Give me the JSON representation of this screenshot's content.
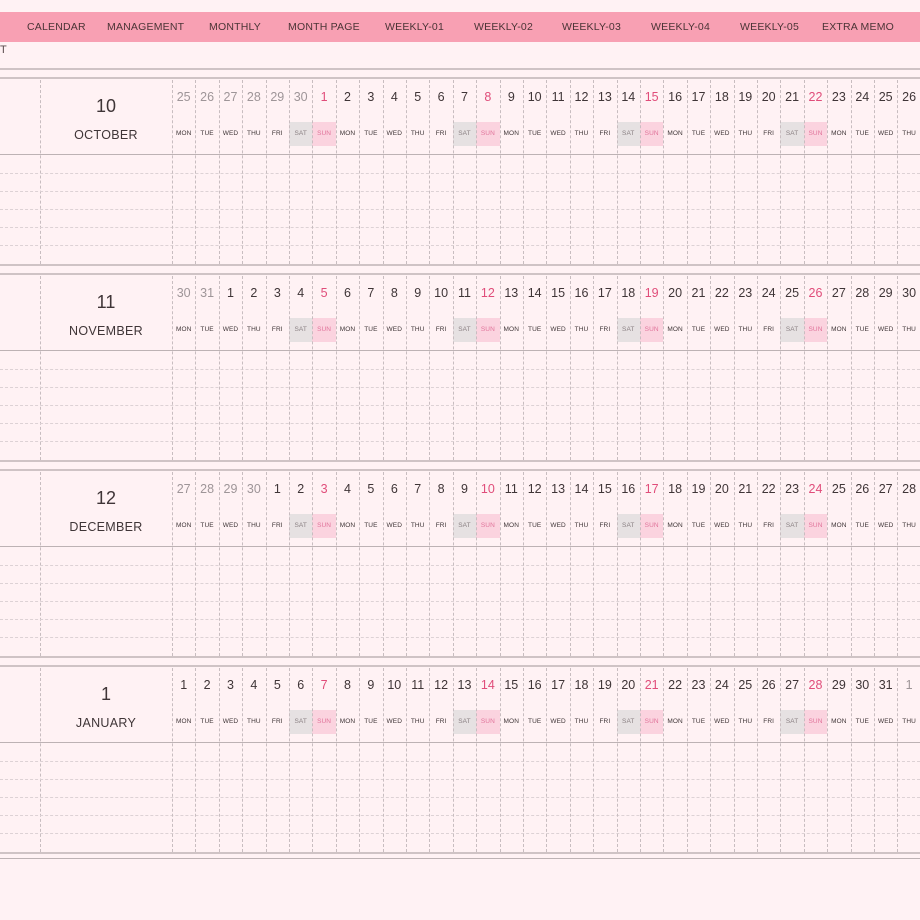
{
  "nav": {
    "tabs": [
      "CALENDAR",
      "MANAGEMENT",
      "MONTHLY",
      "MONTH PAGE",
      "WEEKLY-01",
      "WEEKLY-02",
      "WEEKLY-03",
      "WEEKLY-04",
      "WEEKLY-05",
      "EXTRA MEMO"
    ]
  },
  "subheader": {
    "text": "T"
  },
  "colors": {
    "nav_bg": "#f8a0b3",
    "page_bg": "#fff2f4",
    "sunday": "#e04d7a",
    "sunday_bg": "#fbd3df",
    "saturday_bg": "#e6e1e2"
  },
  "months": [
    {
      "number": "10",
      "name": "OCTOBER",
      "days": [
        {
          "d": "25",
          "wd": "MON",
          "muted": true
        },
        {
          "d": "26",
          "wd": "TUE",
          "muted": true
        },
        {
          "d": "27",
          "wd": "WED",
          "muted": true
        },
        {
          "d": "28",
          "wd": "THU",
          "muted": true
        },
        {
          "d": "29",
          "wd": "FRI",
          "muted": true
        },
        {
          "d": "30",
          "wd": "SAT",
          "muted": true
        },
        {
          "d": "1",
          "wd": "SUN"
        },
        {
          "d": "2",
          "wd": "MON"
        },
        {
          "d": "3",
          "wd": "TUE"
        },
        {
          "d": "4",
          "wd": "WED"
        },
        {
          "d": "5",
          "wd": "THU"
        },
        {
          "d": "6",
          "wd": "FRI"
        },
        {
          "d": "7",
          "wd": "SAT"
        },
        {
          "d": "8",
          "wd": "SUN"
        },
        {
          "d": "9",
          "wd": "MON"
        },
        {
          "d": "10",
          "wd": "TUE"
        },
        {
          "d": "11",
          "wd": "WED"
        },
        {
          "d": "12",
          "wd": "THU"
        },
        {
          "d": "13",
          "wd": "FRI"
        },
        {
          "d": "14",
          "wd": "SAT"
        },
        {
          "d": "15",
          "wd": "SUN"
        },
        {
          "d": "16",
          "wd": "MON"
        },
        {
          "d": "17",
          "wd": "TUE"
        },
        {
          "d": "18",
          "wd": "WED"
        },
        {
          "d": "19",
          "wd": "THU"
        },
        {
          "d": "20",
          "wd": "FRI"
        },
        {
          "d": "21",
          "wd": "SAT"
        },
        {
          "d": "22",
          "wd": "SUN"
        },
        {
          "d": "23",
          "wd": "MON"
        },
        {
          "d": "24",
          "wd": "TUE"
        },
        {
          "d": "25",
          "wd": "WED"
        },
        {
          "d": "26",
          "wd": "THU"
        }
      ]
    },
    {
      "number": "11",
      "name": "NOVEMBER",
      "days": [
        {
          "d": "30",
          "wd": "MON",
          "muted": true
        },
        {
          "d": "31",
          "wd": "TUE",
          "muted": true
        },
        {
          "d": "1",
          "wd": "WED"
        },
        {
          "d": "2",
          "wd": "THU"
        },
        {
          "d": "3",
          "wd": "FRI"
        },
        {
          "d": "4",
          "wd": "SAT"
        },
        {
          "d": "5",
          "wd": "SUN"
        },
        {
          "d": "6",
          "wd": "MON"
        },
        {
          "d": "7",
          "wd": "TUE"
        },
        {
          "d": "8",
          "wd": "WED"
        },
        {
          "d": "9",
          "wd": "THU"
        },
        {
          "d": "10",
          "wd": "FRI"
        },
        {
          "d": "11",
          "wd": "SAT"
        },
        {
          "d": "12",
          "wd": "SUN"
        },
        {
          "d": "13",
          "wd": "MON"
        },
        {
          "d": "14",
          "wd": "TUE"
        },
        {
          "d": "15",
          "wd": "WED"
        },
        {
          "d": "16",
          "wd": "THU"
        },
        {
          "d": "17",
          "wd": "FRI"
        },
        {
          "d": "18",
          "wd": "SAT"
        },
        {
          "d": "19",
          "wd": "SUN"
        },
        {
          "d": "20",
          "wd": "MON"
        },
        {
          "d": "21",
          "wd": "TUE"
        },
        {
          "d": "22",
          "wd": "WED"
        },
        {
          "d": "23",
          "wd": "THU"
        },
        {
          "d": "24",
          "wd": "FRI"
        },
        {
          "d": "25",
          "wd": "SAT"
        },
        {
          "d": "26",
          "wd": "SUN"
        },
        {
          "d": "27",
          "wd": "MON"
        },
        {
          "d": "28",
          "wd": "TUE"
        },
        {
          "d": "29",
          "wd": "WED"
        },
        {
          "d": "30",
          "wd": "THU"
        }
      ]
    },
    {
      "number": "12",
      "name": "DECEMBER",
      "days": [
        {
          "d": "27",
          "wd": "MON",
          "muted": true
        },
        {
          "d": "28",
          "wd": "TUE",
          "muted": true
        },
        {
          "d": "29",
          "wd": "WED",
          "muted": true
        },
        {
          "d": "30",
          "wd": "THU",
          "muted": true
        },
        {
          "d": "1",
          "wd": "FRI"
        },
        {
          "d": "2",
          "wd": "SAT"
        },
        {
          "d": "3",
          "wd": "SUN"
        },
        {
          "d": "4",
          "wd": "MON"
        },
        {
          "d": "5",
          "wd": "TUE"
        },
        {
          "d": "6",
          "wd": "WED"
        },
        {
          "d": "7",
          "wd": "THU"
        },
        {
          "d": "8",
          "wd": "FRI"
        },
        {
          "d": "9",
          "wd": "SAT"
        },
        {
          "d": "10",
          "wd": "SUN"
        },
        {
          "d": "11",
          "wd": "MON"
        },
        {
          "d": "12",
          "wd": "TUE"
        },
        {
          "d": "13",
          "wd": "WED"
        },
        {
          "d": "14",
          "wd": "THU"
        },
        {
          "d": "15",
          "wd": "FRI"
        },
        {
          "d": "16",
          "wd": "SAT"
        },
        {
          "d": "17",
          "wd": "SUN"
        },
        {
          "d": "18",
          "wd": "MON"
        },
        {
          "d": "19",
          "wd": "TUE"
        },
        {
          "d": "20",
          "wd": "WED"
        },
        {
          "d": "21",
          "wd": "THU"
        },
        {
          "d": "22",
          "wd": "FRI"
        },
        {
          "d": "23",
          "wd": "SAT"
        },
        {
          "d": "24",
          "wd": "SUN"
        },
        {
          "d": "25",
          "wd": "MON"
        },
        {
          "d": "26",
          "wd": "TUE"
        },
        {
          "d": "27",
          "wd": "WED"
        },
        {
          "d": "28",
          "wd": "THU"
        }
      ]
    },
    {
      "number": "1",
      "name": "JANUARY",
      "days": [
        {
          "d": "1",
          "wd": "MON"
        },
        {
          "d": "2",
          "wd": "TUE"
        },
        {
          "d": "3",
          "wd": "WED"
        },
        {
          "d": "4",
          "wd": "THU"
        },
        {
          "d": "5",
          "wd": "FRI"
        },
        {
          "d": "6",
          "wd": "SAT"
        },
        {
          "d": "7",
          "wd": "SUN"
        },
        {
          "d": "8",
          "wd": "MON"
        },
        {
          "d": "9",
          "wd": "TUE"
        },
        {
          "d": "10",
          "wd": "WED"
        },
        {
          "d": "11",
          "wd": "THU"
        },
        {
          "d": "12",
          "wd": "FRI"
        },
        {
          "d": "13",
          "wd": "SAT"
        },
        {
          "d": "14",
          "wd": "SUN"
        },
        {
          "d": "15",
          "wd": "MON"
        },
        {
          "d": "16",
          "wd": "TUE"
        },
        {
          "d": "17",
          "wd": "WED"
        },
        {
          "d": "18",
          "wd": "THU"
        },
        {
          "d": "19",
          "wd": "FRI"
        },
        {
          "d": "20",
          "wd": "SAT"
        },
        {
          "d": "21",
          "wd": "SUN"
        },
        {
          "d": "22",
          "wd": "MON"
        },
        {
          "d": "23",
          "wd": "TUE"
        },
        {
          "d": "24",
          "wd": "WED"
        },
        {
          "d": "25",
          "wd": "THU"
        },
        {
          "d": "26",
          "wd": "FRI"
        },
        {
          "d": "27",
          "wd": "SAT"
        },
        {
          "d": "28",
          "wd": "SUN"
        },
        {
          "d": "29",
          "wd": "MON"
        },
        {
          "d": "30",
          "wd": "TUE"
        },
        {
          "d": "31",
          "wd": "WED"
        },
        {
          "d": "1",
          "wd": "THU",
          "muted": true
        }
      ]
    }
  ]
}
